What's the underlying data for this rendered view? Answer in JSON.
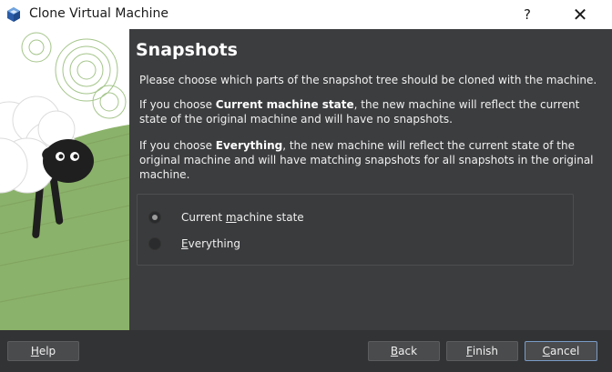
{
  "window": {
    "title": "Clone Virtual Machine",
    "help_glyph": "?",
    "close_glyph": "✕"
  },
  "page": {
    "heading": "Snapshots",
    "intro": "Please choose which parts of the snapshot tree should be cloned with the machine.",
    "current_para": {
      "prefix": "If you choose ",
      "emphasis": "Current machine state",
      "suffix": ", the new machine will reflect the current state of the original machine and will have no snapshots."
    },
    "everything_para": {
      "prefix": "If you choose ",
      "emphasis": "Everything",
      "suffix": ", the new machine will reflect the current state of the original machine and will have matching snapshots for all snapshots in the original machine."
    }
  },
  "options": {
    "current": {
      "before": "Current ",
      "mnemonic": "m",
      "after": "achine state",
      "checked": true
    },
    "everything": {
      "before": "",
      "mnemonic": "E",
      "after": "verything",
      "checked": false
    }
  },
  "buttons": {
    "help": {
      "mnemonic": "H",
      "rest": "elp"
    },
    "back": {
      "mnemonic": "B",
      "rest": "ack"
    },
    "finish": {
      "mnemonic": "F",
      "rest": "inish"
    },
    "cancel": {
      "mnemonic": "C",
      "rest": "ancel"
    }
  },
  "colors": {
    "panel_bg": "#3c3d3f",
    "footer_bg": "#323335",
    "grass": "#8bb26a",
    "sky": "#ffffff",
    "focus_border": "#7a9cc6"
  },
  "icons": {
    "app": "virtualbox-cube-icon",
    "mascot": "sheep-illustration"
  }
}
